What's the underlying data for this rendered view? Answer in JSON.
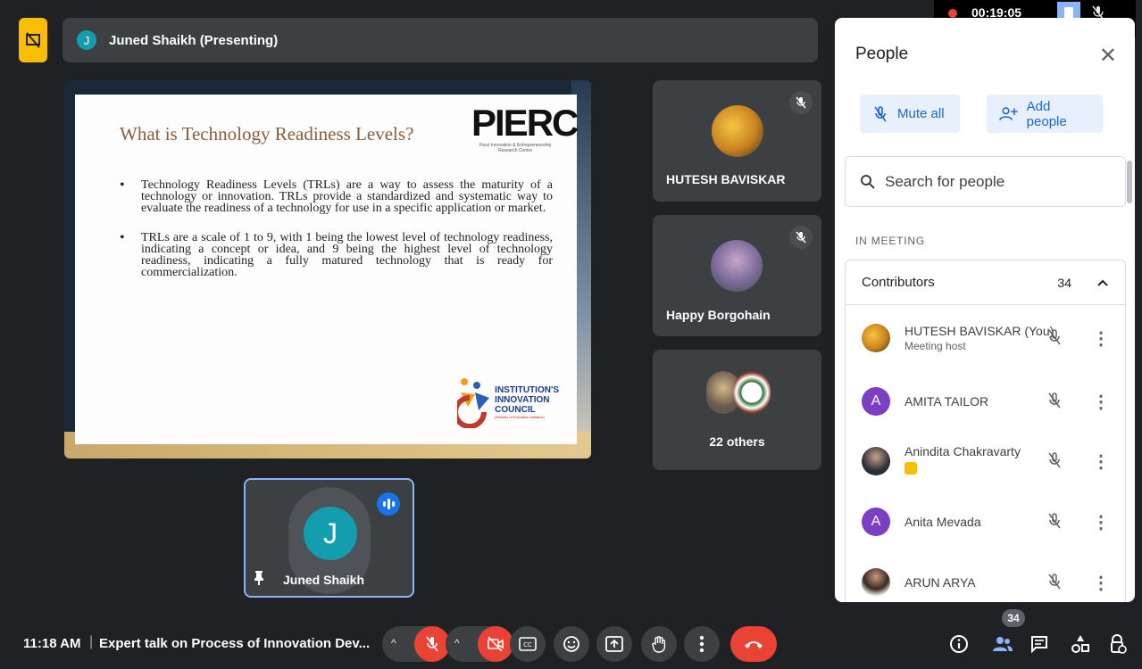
{
  "presenting": {
    "avatar_letter": "J",
    "title": "Juned Shaikh (Presenting)"
  },
  "slide": {
    "title": "What is Technology Readiness Levels?",
    "bullets": [
      "Technology Readiness Levels (TRLs) are a way to assess the maturity of a technology or innovation. TRLs provide a standardized and systematic way to evaluate the readiness of a technology for use in a specific application or market.",
      "TRLs are a scale of 1 to 9, with 1 being the lowest level of technology readiness, indicating a concept or idea, and 9 being the highest level of technology readiness, indicating a fully matured technology that is ready for commercialization."
    ],
    "logo_top": "PIERC",
    "logo_top_sub": "Parul Innovation & Entrepreneurship Research Centre",
    "logo_bottom_lines": [
      "INSTITUTION'S",
      "INNOVATION",
      "COUNCIL"
    ],
    "logo_bottom_sub": "(Ministry of Education Initiative)"
  },
  "tiles": {
    "t1_name": "HUTESH BAVISKAR",
    "t2_name": "Happy Borgohain",
    "t3_name": "22 others",
    "self_letter": "J",
    "self_name": "Juned Shaikh"
  },
  "recording": {
    "time": "00:19:05"
  },
  "people_panel": {
    "title": "People",
    "mute_all": "Mute all",
    "add_people": "Add people",
    "search_placeholder": "Search for people",
    "section": "IN MEETING",
    "group_label": "Contributors",
    "group_count": "34",
    "participants": [
      {
        "name": "HUTESH BAVISKAR (You)",
        "sub": "Meeting host",
        "avatar": ""
      },
      {
        "name": "AMITA TAILOR",
        "sub": "",
        "avatar": "A"
      },
      {
        "name": "Anindita Chakravarty",
        "sub": "",
        "avatar": ""
      },
      {
        "name": "Anita Mevada",
        "sub": "",
        "avatar": "A"
      },
      {
        "name": "ARUN ARYA",
        "sub": "",
        "avatar": ""
      }
    ]
  },
  "bottom": {
    "clock": "11:18 AM",
    "separator": "|",
    "meeting_title": "Expert talk on Process of Innovation Dev...",
    "people_badge": "34"
  },
  "colors": {
    "accent_blue": "#1a73e8",
    "danger_red": "#ea4335",
    "avatar_teal": "#129eaf",
    "avatar_purple": "#7b3fc4",
    "present_yellow": "#fbbc04"
  }
}
